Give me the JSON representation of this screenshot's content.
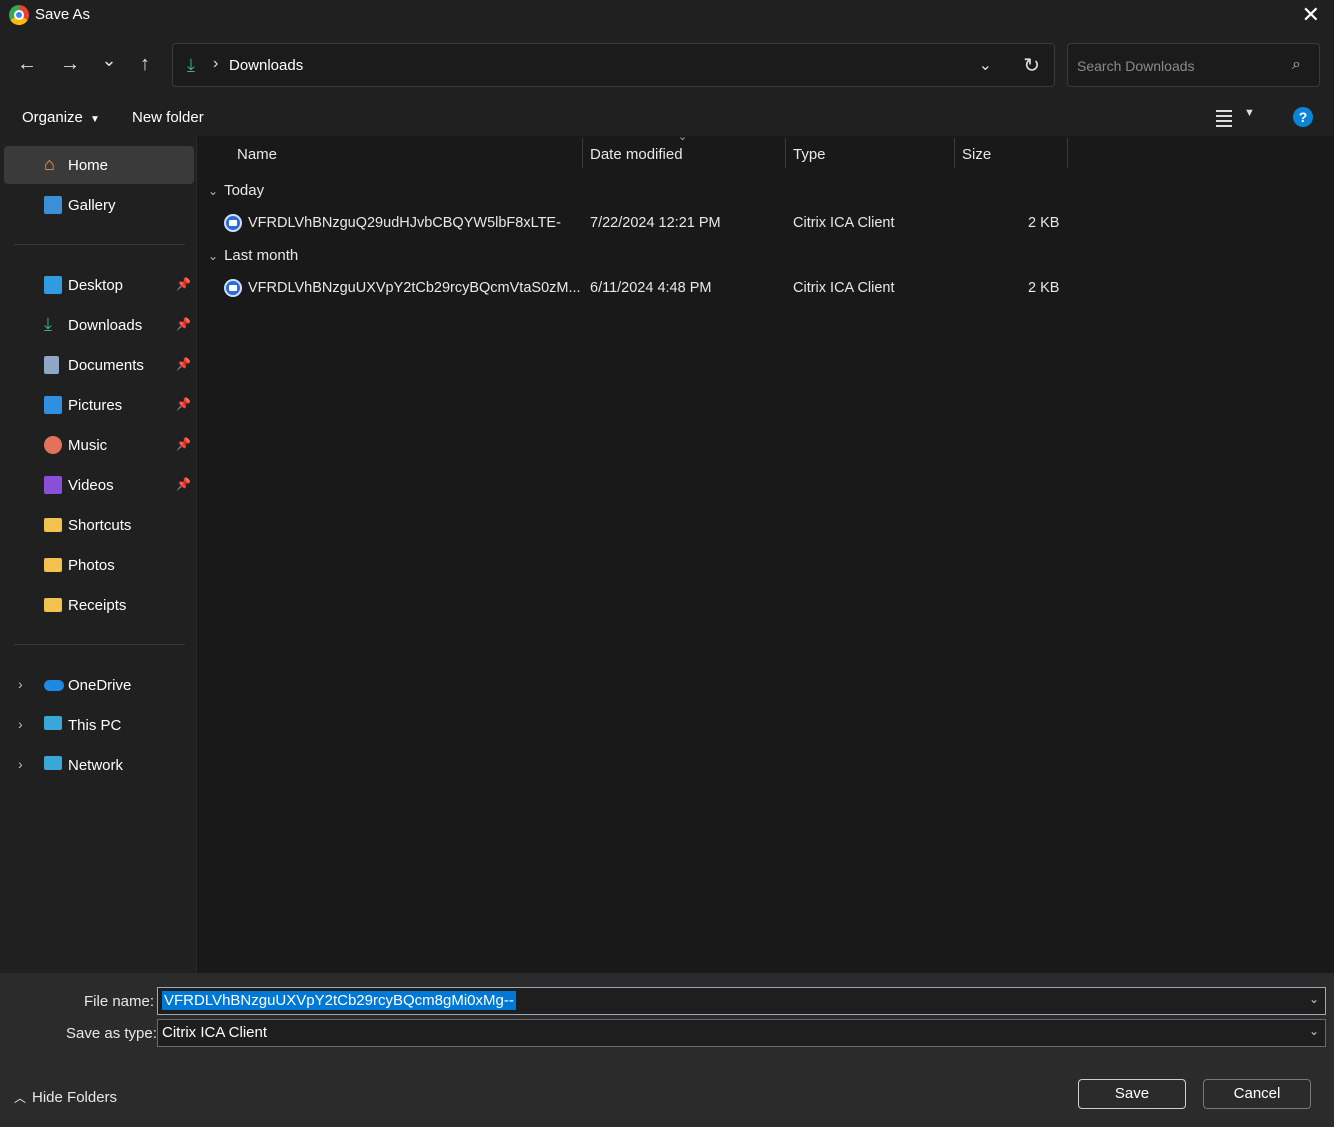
{
  "window": {
    "title": "Save As"
  },
  "nav": {
    "back_icon": "←",
    "forward_icon": "→",
    "recent_icon": "⌄",
    "up_icon": "↑",
    "address": {
      "breadcrumb": "Downloads"
    },
    "search_placeholder": "Search Downloads"
  },
  "toolbar": {
    "organize": "Organize",
    "new_folder": "New folder",
    "help": "?"
  },
  "sidebar": {
    "home": "Home",
    "gallery": "Gallery",
    "quick_access": [
      {
        "label": "Desktop",
        "pinned": true
      },
      {
        "label": "Downloads",
        "pinned": true
      },
      {
        "label": "Documents",
        "pinned": true
      },
      {
        "label": "Pictures",
        "pinned": true
      },
      {
        "label": "Music",
        "pinned": true
      },
      {
        "label": "Videos",
        "pinned": true
      },
      {
        "label": "Shortcuts",
        "pinned": false
      },
      {
        "label": "Photos",
        "pinned": false
      },
      {
        "label": "Receipts",
        "pinned": false
      }
    ],
    "locations": [
      "OneDrive",
      "This PC",
      "Network"
    ]
  },
  "columns": {
    "name": "Name",
    "date": "Date modified",
    "type": "Type",
    "size": "Size"
  },
  "groups": [
    {
      "label": "Today",
      "files": [
        {
          "name": "VFRDLVhBNzguQ29udHJvbCBQYW5lbF8xLTE-",
          "date": "7/22/2024 12:21 PM",
          "type": "Citrix ICA Client",
          "size": "2 KB"
        }
      ]
    },
    {
      "label": "Last month",
      "files": [
        {
          "name": "VFRDLVhBNzguUXVpY2tCb29rcyBQcmVtaS0zM...",
          "date": "6/11/2024 4:48 PM",
          "type": "Citrix ICA Client",
          "size": "2 KB"
        }
      ]
    }
  ],
  "form": {
    "file_name_label": "File name:",
    "file_name_value": "VFRDLVhBNzguUXVpY2tCb29rcyBQcm8gMi0xMg--",
    "save_type_label": "Save as type:",
    "save_type_value": "Citrix ICA Client",
    "hide_folders": "Hide Folders",
    "save": "Save",
    "cancel": "Cancel"
  },
  "colors": {
    "accent": "#0078d7",
    "downloads_green": "#3fb07d",
    "help_blue": "#0a84d8"
  }
}
